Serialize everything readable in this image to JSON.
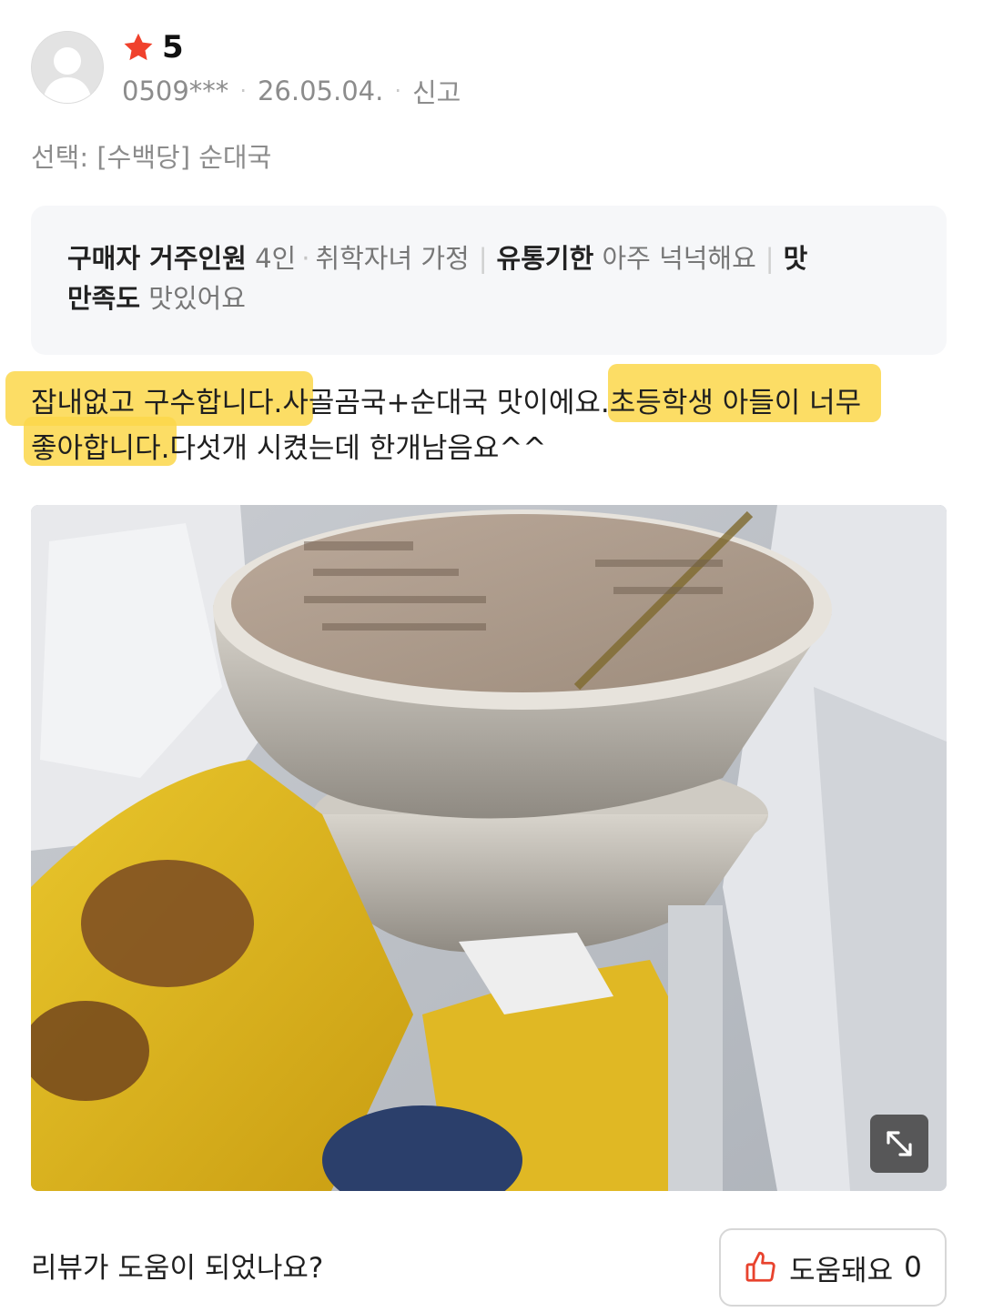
{
  "review": {
    "rating": "5",
    "user_id": "0509***",
    "date": "26.05.04.",
    "report_label": "신고",
    "option_text": "선택: [수백당] 순대국",
    "survey": {
      "household_label": "구매자 거주인원",
      "household_value": "4인",
      "household_extra": "취학자녀 가정",
      "expiry_label": "유통기한",
      "expiry_value": "아주 넉넉해요",
      "taste_label_1": "맛",
      "taste_label_2": "만족도",
      "taste_value": "맛있어요"
    },
    "body_line1": "잡내없고 구수합니다.사골곰국+순대국 맛이에요.초등학생 아들이 너무",
    "body_line2": "좋아합니다.다섯개 시켰는데 한개남음요^^"
  },
  "photo": {
    "icon": "expand-icon"
  },
  "footer": {
    "question": "리뷰가 도움이 되었나요?",
    "helpful_label": "도움돼요",
    "helpful_count": "0"
  },
  "colors": {
    "star": "#f0412c",
    "highlight": "#fcd74a",
    "thumb": "#e8432e"
  }
}
